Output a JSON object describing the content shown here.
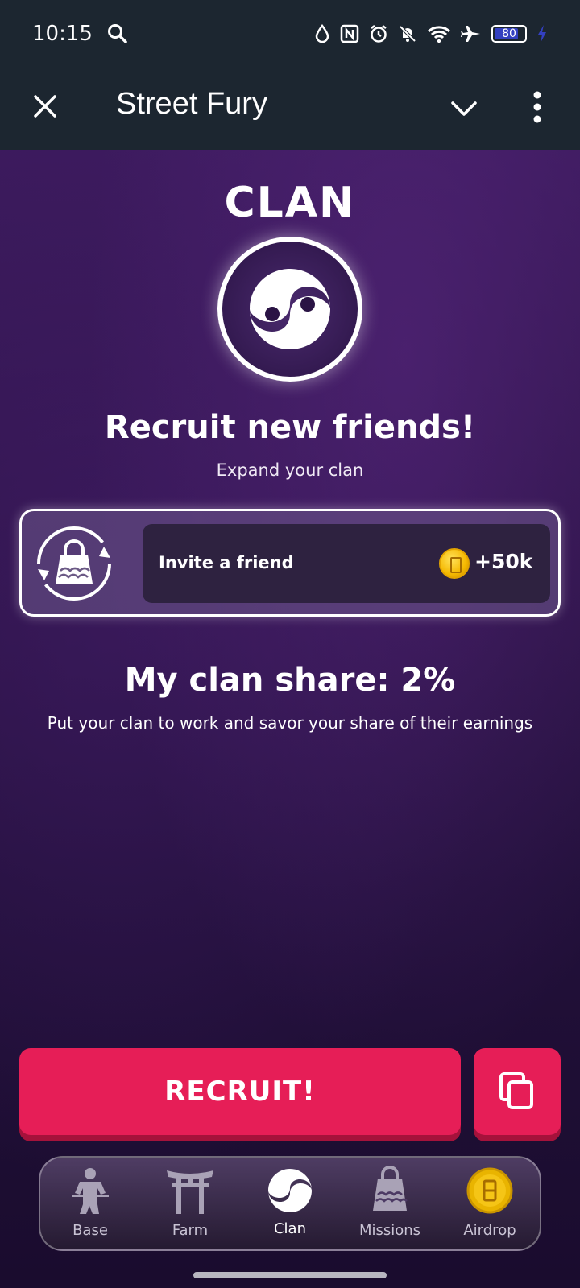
{
  "status_bar": {
    "time": "10:15",
    "battery": "80",
    "battery_fraction": 0.8,
    "icons": [
      "search-icon",
      "water-drop-icon",
      "nfc-icon",
      "alarm-icon",
      "bell-off-icon",
      "wifi-icon",
      "airplane-icon",
      "battery-icon",
      "charging-icon"
    ]
  },
  "app_bar": {
    "title": "Street Fury",
    "icons": [
      "close-icon",
      "chevron-down-icon",
      "more-vert-icon"
    ]
  },
  "game": {
    "heading": "CLAN",
    "recruit_title": "Recruit new friends!",
    "recruit_subtitle": "Expand your clan",
    "invite": {
      "label": "Invite a friend",
      "reward": "+50k",
      "icon": "bag-refresh-icon",
      "coin_icon": "coin-icon"
    },
    "share_title": "My clan share: 2%",
    "share_subtitle": "Put your clan to work and savor your share of their earnings",
    "recruit_button": "RECRUIT!",
    "copy_icon": "copy-icon"
  },
  "nav": {
    "items": [
      {
        "label": "Base",
        "icon": "fighter-icon"
      },
      {
        "label": "Farm",
        "icon": "torii-gate-icon"
      },
      {
        "label": "Clan",
        "icon": "clan-emblem-icon",
        "active": true
      },
      {
        "label": "Missions",
        "icon": "bag-icon"
      },
      {
        "label": "Airdrop",
        "icon": "coin-icon"
      }
    ]
  },
  "colors": {
    "accent": "#e61e57",
    "background": "#2e1449",
    "system_bar": "#1c2630",
    "coin": "#f5b800"
  }
}
